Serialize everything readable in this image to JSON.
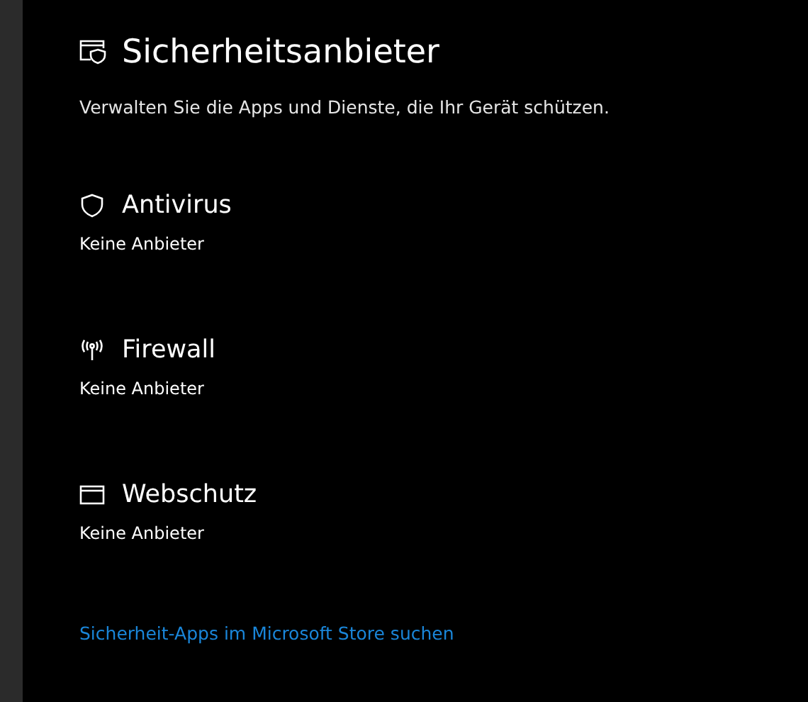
{
  "page": {
    "title": "Sicherheitsanbieter",
    "description": "Verwalten Sie die Apps und Dienste, die Ihr Gerät schützen."
  },
  "sections": [
    {
      "kind": "antivirus",
      "title": "Antivirus",
      "status": "Keine Anbieter"
    },
    {
      "kind": "firewall",
      "title": "Firewall",
      "status": "Keine Anbieter"
    },
    {
      "kind": "web",
      "title": "Webschutz",
      "status": "Keine Anbieter"
    }
  ],
  "store_link": "Sicherheit-Apps im Microsoft Store suchen"
}
